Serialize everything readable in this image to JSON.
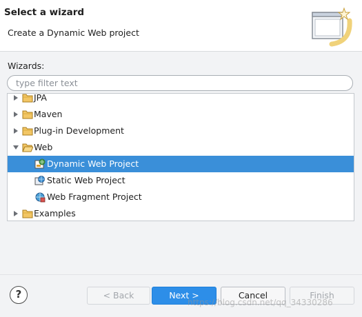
{
  "header": {
    "title": "Select a wizard",
    "subtitle": "Create a Dynamic Web project"
  },
  "wizards_label": "Wizards:",
  "filter": {
    "placeholder": "type filter text",
    "value": ""
  },
  "tree": {
    "items": [
      {
        "label": "JPA",
        "expanded": false
      },
      {
        "label": "Maven",
        "expanded": false
      },
      {
        "label": "Plug-in Development",
        "expanded": false
      },
      {
        "label": "Web",
        "expanded": true,
        "children": [
          {
            "label": "Dynamic Web Project",
            "selected": true
          },
          {
            "label": "Static Web Project"
          },
          {
            "label": "Web Fragment Project"
          }
        ]
      },
      {
        "label": "Examples",
        "expanded": false
      }
    ]
  },
  "buttons": {
    "help": "?",
    "back": "< Back",
    "next": "Next >",
    "cancel": "Cancel",
    "finish": "Finish"
  },
  "watermark": "https://blog.csdn.net/qq_34330286",
  "colors": {
    "selection": "#3a8fd9",
    "primary_button": "#2d8ee8",
    "folder": "#e8b84a"
  },
  "icons": {
    "collapsed": "triangle-right-icon",
    "expanded": "triangle-down-icon",
    "folder": "folder-icon",
    "project": "web-project-icon",
    "help": "help-icon",
    "banner": "wizard-banner-icon"
  }
}
